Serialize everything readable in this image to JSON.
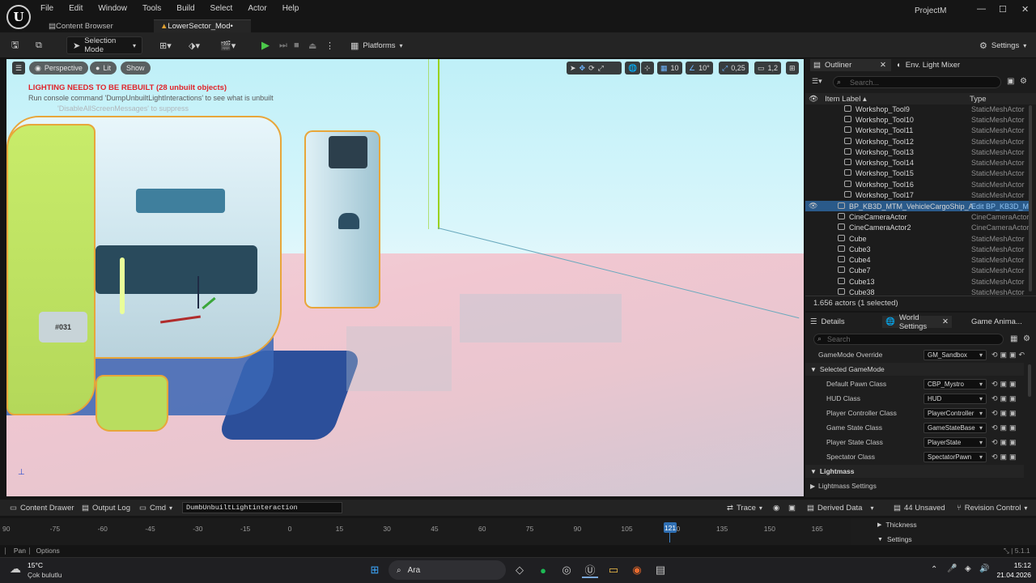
{
  "window": {
    "project": "ProjectM",
    "minimize": "—",
    "maximize": "☐",
    "close": "✕"
  },
  "menu": [
    "File",
    "Edit",
    "Window",
    "Tools",
    "Build",
    "Select",
    "Actor",
    "Help"
  ],
  "tabs": [
    {
      "label": "Content Browser"
    },
    {
      "label": "LowerSector_Mod•"
    }
  ],
  "toolbar": {
    "mode": "Selection Mode",
    "platforms": "Platforms",
    "settings": "Settings"
  },
  "viewport": {
    "perspective": "Perspective",
    "lit": "Lit",
    "show": "Show",
    "grid_snap": "10",
    "rot_snap": "10°",
    "scale_snap": "0,25",
    "cam_speed": "1,2",
    "warning": "LIGHTING NEEDS TO BE REBUILT (28 unbuilt objects)",
    "hint": "Run console command 'DumpUnbuiltLightInteractions' to see what is unbuilt",
    "hint2": "'DisableAllScreenMessages' to suppress",
    "ship_number": "#031"
  },
  "outliner": {
    "tab": "Outliner",
    "tab2": "Env. Light Mixer",
    "search_placeholder": "Search...",
    "col_label": "Item Label ▴",
    "col_type": "Type",
    "rows": [
      {
        "label": "Workshop_Tool9",
        "type": "StaticMeshActor"
      },
      {
        "label": "Workshop_Tool10",
        "type": "StaticMeshActor"
      },
      {
        "label": "Workshop_Tool11",
        "type": "StaticMeshActor"
      },
      {
        "label": "Workshop_Tool12",
        "type": "StaticMeshActor"
      },
      {
        "label": "Workshop_Tool13",
        "type": "StaticMeshActor"
      },
      {
        "label": "Workshop_Tool14",
        "type": "StaticMeshActor"
      },
      {
        "label": "Workshop_Tool15",
        "type": "StaticMeshActor"
      },
      {
        "label": "Workshop_Tool16",
        "type": "StaticMeshActor"
      },
      {
        "label": "Workshop_Tool17",
        "type": "StaticMeshActor"
      },
      {
        "label": "BP_KB3D_MTM_VehicleCargoShip_A",
        "type": "Edit BP_KB3D_M"
      },
      {
        "label": "CineCameraActor",
        "type": "CineCameraActor"
      },
      {
        "label": "CineCameraActor2",
        "type": "CineCameraActor"
      },
      {
        "label": "Cube",
        "type": "StaticMeshActor"
      },
      {
        "label": "Cube3",
        "type": "StaticMeshActor"
      },
      {
        "label": "Cube4",
        "type": "StaticMeshActor"
      },
      {
        "label": "Cube7",
        "type": "StaticMeshActor"
      },
      {
        "label": "Cube13",
        "type": "StaticMeshActor"
      },
      {
        "label": "Cube38",
        "type": "StaticMeshActor"
      }
    ],
    "count": "1.656 actors (1 selected)"
  },
  "details": {
    "tab": "Details",
    "tab2": "World Settings",
    "tab3": "Game Anima...",
    "search_placeholder": "Search",
    "gamemode_label": "GameMode Override",
    "gamemode_value": "GM_Sandbox",
    "section_selected": "Selected GameMode",
    "props": [
      {
        "label": "Default Pawn Class",
        "value": "CBP_Mystro"
      },
      {
        "label": "HUD Class",
        "value": "HUD"
      },
      {
        "label": "Player Controller Class",
        "value": "PlayerController"
      },
      {
        "label": "Game State Class",
        "value": "GameStateBase"
      },
      {
        "label": "Player State Class",
        "value": "PlayerState"
      },
      {
        "label": "Spectator Class",
        "value": "SpectatorPawn"
      }
    ],
    "section_lightmass": "Lightmass",
    "lightmass_settings": "Lightmass Settings"
  },
  "drawer": {
    "content_drawer": "Content Drawer",
    "output_log": "Output Log",
    "cmd": "Cmd",
    "cmd_value": "DumbUnbuiltLightinteraction",
    "trace": "Trace",
    "derived": "Derived Data",
    "unsaved": "44 Unsaved",
    "revision": "Revision Control"
  },
  "timeline": {
    "ticks": [
      "90",
      "-75",
      "-60",
      "-45",
      "-30",
      "-15",
      "0",
      "15",
      "30",
      "45",
      "60",
      "75",
      "90",
      "105",
      "120",
      "135",
      "150",
      "165"
    ],
    "current": "121",
    "tracks": [
      {
        "label": "Thickness"
      },
      {
        "label": "Settings"
      }
    ]
  },
  "statusbar": {
    "pan": "Pan",
    "options": "Options",
    "version": "5.1.1"
  },
  "taskbar": {
    "temp": "15°C",
    "weather": "Çok bulutlu",
    "search": "Ara",
    "time": "15:12",
    "date": "21.04.2026"
  }
}
